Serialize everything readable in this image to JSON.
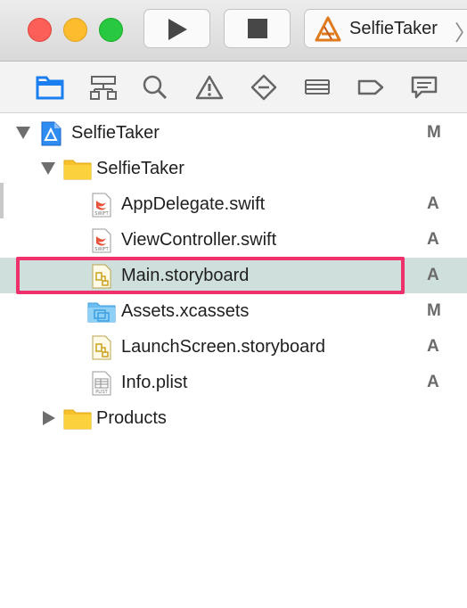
{
  "toolbar": {
    "run_icon": "play-icon",
    "stop_icon": "stop-icon",
    "scheme": {
      "name": "SelfieTaker",
      "icon": "xcode-app-icon"
    }
  },
  "navigator_tabs": [
    "project-navigator-icon",
    "symbol-navigator-icon",
    "find-navigator-icon",
    "issue-navigator-icon",
    "test-navigator-icon",
    "debug-navigator-icon",
    "breakpoint-navigator-icon",
    "report-navigator-icon"
  ],
  "tree": {
    "project": {
      "name": "SelfieTaker",
      "status": "M"
    },
    "group": {
      "name": "SelfieTaker"
    },
    "files": [
      {
        "name": "AppDelegate.swift",
        "status": "A",
        "icon": "swift-file-icon"
      },
      {
        "name": "ViewController.swift",
        "status": "A",
        "icon": "swift-file-icon"
      },
      {
        "name": "Main.storyboard",
        "status": "A",
        "icon": "storyboard-file-icon"
      },
      {
        "name": "Assets.xcassets",
        "status": "M",
        "icon": "asset-catalog-icon"
      },
      {
        "name": "LaunchScreen.storyboard",
        "status": "A",
        "icon": "storyboard-file-icon"
      },
      {
        "name": "Info.plist",
        "status": "A",
        "icon": "plist-file-icon"
      }
    ],
    "products": {
      "name": "Products"
    }
  },
  "colors": {
    "highlight_border": "#f0306a",
    "selection_background": "#cfe0dc",
    "navigator_active": "#1a7ef0"
  }
}
